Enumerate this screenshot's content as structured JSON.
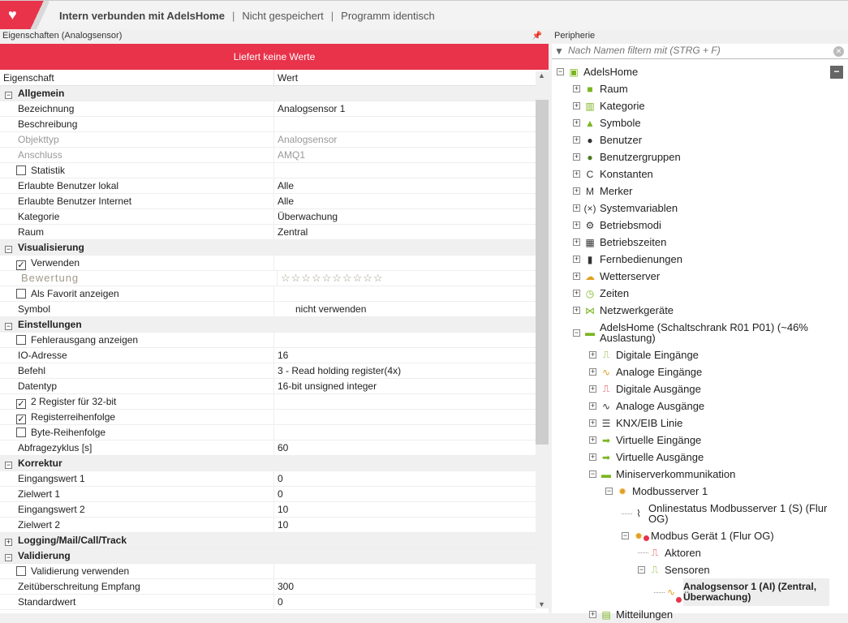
{
  "topbar": {
    "connection": "Intern verbunden mit AdelsHome",
    "saved": "Nicht gespeichert",
    "program": "Programm identisch",
    "sep": "|"
  },
  "left": {
    "title": "Eigenschaften (Analogsensor)",
    "pin": "📌",
    "banner": "Liefert keine Werte",
    "col_prop": "Eigenschaft",
    "col_val": "Wert",
    "rows": [
      {
        "t": "cat",
        "k": "Allgemein",
        "tog": "−"
      },
      {
        "k": "Bezeichnung",
        "v": "Analogsensor 1"
      },
      {
        "k": "Beschreibung",
        "v": ""
      },
      {
        "t": "dis",
        "k": "Objekttyp",
        "v": "Analogsensor"
      },
      {
        "t": "dis",
        "k": "Anschluss",
        "v": "AMQ1"
      },
      {
        "t": "chk",
        "k": "Statistik",
        "c": ""
      },
      {
        "k": "Erlaubte Benutzer lokal",
        "v": "Alle"
      },
      {
        "k": "Erlaubte Benutzer Internet",
        "v": "Alle"
      },
      {
        "k": "Kategorie",
        "v": "Überwachung"
      },
      {
        "k": "Raum",
        "v": "Zentral"
      },
      {
        "t": "cat",
        "k": "Visualisierung",
        "tog": "−"
      },
      {
        "t": "chk",
        "k": "Verwenden",
        "c": "✓"
      },
      {
        "t": "stars",
        "k": "Bewertung",
        "v": "☆☆☆☆☆☆☆☆☆☆",
        "rating": 0
      },
      {
        "t": "chk",
        "k": "Als Favorit anzeigen",
        "c": ""
      },
      {
        "t": "sym",
        "k": "Symbol",
        "v": "nicht verwenden"
      },
      {
        "t": "cat",
        "k": "Einstellungen",
        "tog": "−"
      },
      {
        "t": "chk",
        "k": "Fehlerausgang anzeigen",
        "c": ""
      },
      {
        "k": "IO-Adresse",
        "v": "16"
      },
      {
        "k": "Befehl",
        "v": "3 - Read holding register(4x)"
      },
      {
        "k": "Datentyp",
        "v": "16-bit unsigned integer"
      },
      {
        "t": "chk",
        "k": "2 Register für 32-bit",
        "c": "✓"
      },
      {
        "t": "chk",
        "k": "Registerreihenfolge",
        "c": "✓"
      },
      {
        "t": "chk",
        "k": "Byte-Reihenfolge",
        "c": ""
      },
      {
        "k": "Abfragezyklus [s]",
        "v": "60"
      },
      {
        "t": "cat",
        "k": "Korrektur",
        "tog": "−"
      },
      {
        "k": "Eingangswert 1",
        "v": "0"
      },
      {
        "k": "Zielwert 1",
        "v": "0"
      },
      {
        "k": "Eingangswert 2",
        "v": "10"
      },
      {
        "k": "Zielwert 2",
        "v": "10"
      },
      {
        "t": "cat",
        "k": "Logging/Mail/Call/Track",
        "tog": "+"
      },
      {
        "t": "cat",
        "k": "Validierung",
        "tog": "−"
      },
      {
        "t": "chk",
        "k": "Validierung verwenden",
        "c": ""
      },
      {
        "k": "Zeitüberschreitung Empfang",
        "v": "300"
      },
      {
        "k": "Standardwert",
        "v": "0"
      }
    ]
  },
  "right": {
    "title": "Peripherie",
    "filter_placeholder": "Nach Namen filtern mit (STRG + F)",
    "tree": [
      {
        "l": 0,
        "tg": "−",
        "ic": "▣",
        "c": "#7ab51d",
        "n": "AdelsHome"
      },
      {
        "l": 1,
        "tg": "+",
        "ic": "■",
        "c": "#7ab51d",
        "n": "Raum"
      },
      {
        "l": 1,
        "tg": "+",
        "ic": "▥",
        "c": "#7ab51d",
        "n": "Kategorie"
      },
      {
        "l": 1,
        "tg": "+",
        "ic": "▲",
        "c": "#7ab51d",
        "n": "Symbole"
      },
      {
        "l": 1,
        "tg": "+",
        "ic": "●",
        "c": "#333",
        "n": "Benutzer"
      },
      {
        "l": 1,
        "tg": "+",
        "ic": "●",
        "c": "#4a7a20",
        "n": "Benutzergruppen"
      },
      {
        "l": 1,
        "tg": "+",
        "ic": "C",
        "c": "#333",
        "n": "Konstanten"
      },
      {
        "l": 1,
        "tg": "+",
        "ic": "M",
        "c": "#333",
        "n": "Merker"
      },
      {
        "l": 1,
        "tg": "+",
        "ic": "(×)",
        "c": "#333",
        "n": "Systemvariablen"
      },
      {
        "l": 1,
        "tg": "+",
        "ic": "⚙",
        "c": "#333",
        "n": "Betriebsmodi"
      },
      {
        "l": 1,
        "tg": "+",
        "ic": "▦",
        "c": "#333",
        "n": "Betriebszeiten"
      },
      {
        "l": 1,
        "tg": "+",
        "ic": "▮",
        "c": "#333",
        "n": "Fernbedienungen"
      },
      {
        "l": 1,
        "tg": "+",
        "ic": "☁",
        "c": "#e0a020",
        "n": "Wetterserver"
      },
      {
        "l": 1,
        "tg": "+",
        "ic": "◷",
        "c": "#7ab51d",
        "n": "Zeiten"
      },
      {
        "l": 1,
        "tg": "+",
        "ic": "⋈",
        "c": "#7ab51d",
        "n": "Netzwerkgeräte"
      },
      {
        "l": 1,
        "tg": "−",
        "ic": "▬",
        "c": "#7ab51d",
        "n": "AdelsHome (Schaltschrank R01 P01) (~46% Auslastung)"
      },
      {
        "l": 2,
        "tg": "+",
        "ic": "⎍",
        "c": "#7ab51d",
        "n": "Digitale Eingänge"
      },
      {
        "l": 2,
        "tg": "+",
        "ic": "∿",
        "c": "#e0a020",
        "n": "Analoge Eingänge"
      },
      {
        "l": 2,
        "tg": "+",
        "ic": "⎍",
        "c": "#d33",
        "n": "Digitale Ausgänge"
      },
      {
        "l": 2,
        "tg": "+",
        "ic": "∿",
        "c": "#333",
        "n": "Analoge Ausgänge"
      },
      {
        "l": 2,
        "tg": "+",
        "ic": "☰",
        "c": "#333",
        "n": "KNX/EIB Linie"
      },
      {
        "l": 2,
        "tg": "+",
        "ic": "➡",
        "c": "#7ab51d",
        "n": "Virtuelle Eingänge"
      },
      {
        "l": 2,
        "tg": "+",
        "ic": "➡",
        "c": "#7ab51d",
        "n": "Virtuelle Ausgänge"
      },
      {
        "l": 2,
        "tg": "−",
        "ic": "▬",
        "c": "#7ab51d",
        "n": "Miniserverkommunikation"
      },
      {
        "l": 3,
        "tg": "−",
        "ic": "✹",
        "c": "#e0a020",
        "n": "Modbusserver 1"
      },
      {
        "l": 4,
        "tg": "",
        "ic": "⌇",
        "c": "#333",
        "n": "Onlinestatus Modbusserver 1 (S) (Flur OG)"
      },
      {
        "l": 4,
        "tg": "−",
        "ic": "✹",
        "c": "#e0a020",
        "n": "Modbus Gerät 1 (Flur OG)",
        "dot": true
      },
      {
        "l": 5,
        "tg": "",
        "ic": "⎍",
        "c": "#d33",
        "n": "Aktoren"
      },
      {
        "l": 5,
        "tg": "−",
        "ic": "⎍",
        "c": "#7ab51d",
        "n": "Sensoren"
      },
      {
        "l": 6,
        "tg": "",
        "ic": "∿",
        "c": "#e0a020",
        "n": "Analogsensor 1 (AI) (Zentral, Überwachung)",
        "dot": true,
        "sel": true
      },
      {
        "l": 2,
        "tg": "+",
        "ic": "▤",
        "c": "#7ab51d",
        "n": "Mitteilungen"
      }
    ]
  }
}
